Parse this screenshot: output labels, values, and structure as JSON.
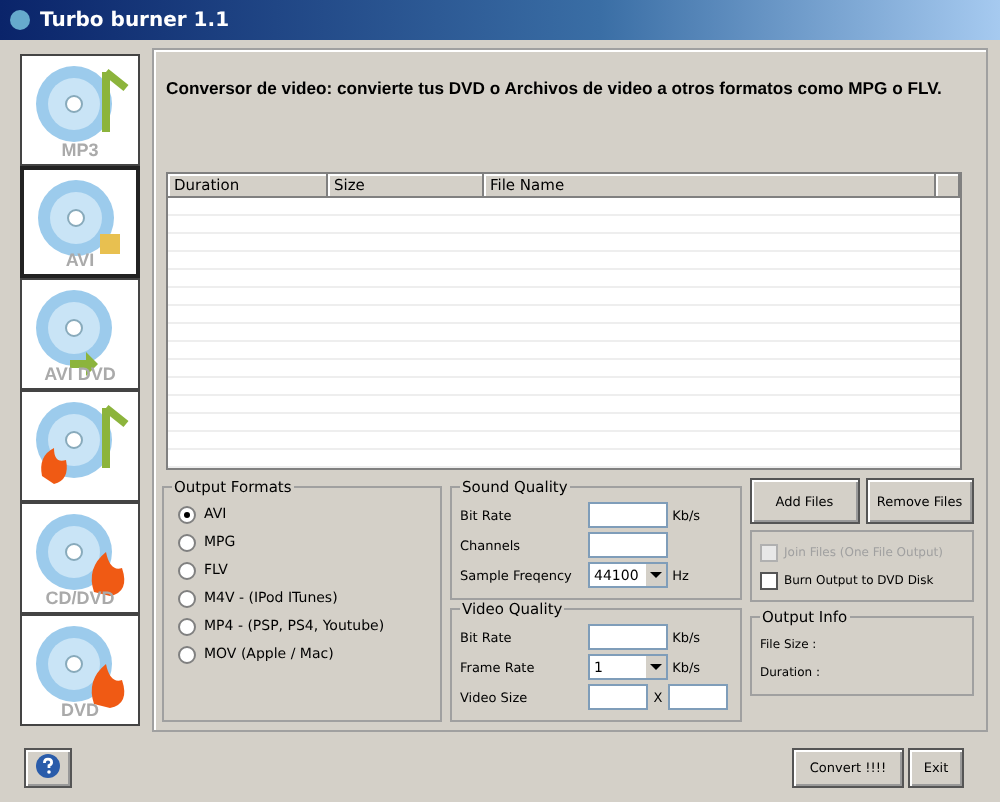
{
  "window": {
    "title": "Turbo burner 1.1"
  },
  "sidebar": {
    "items": [
      {
        "label": "MP3",
        "kind": "music",
        "selected": false
      },
      {
        "label": "AVI",
        "kind": "file",
        "selected": true
      },
      {
        "label": "AVI",
        "label_2": "DVD",
        "kind": "convert",
        "selected": false
      },
      {
        "kind": "burn-music",
        "selected": false
      },
      {
        "label": "CD/DVD",
        "kind": "burn",
        "selected": false
      },
      {
        "label": "DVD",
        "kind": "burn",
        "selected": false
      }
    ]
  },
  "header": "Conversor de video: convierte tus DVD o Archivos de video a otros formatos como MPG o FLV.",
  "table": {
    "columns": [
      "Duration",
      "Size",
      "File Name"
    ]
  },
  "output_formats": {
    "title": "Output Formats",
    "options": [
      {
        "label": "AVI",
        "selected": true
      },
      {
        "label": "MPG",
        "selected": false
      },
      {
        "label": "FLV",
        "selected": false
      },
      {
        "label": "M4V - (IPod ITunes)",
        "selected": false
      },
      {
        "label": "MP4 - (PSP, PS4, Youtube)",
        "selected": false
      },
      {
        "label": "MOV (Apple / Mac)",
        "selected": false
      }
    ]
  },
  "sound_quality": {
    "title": "Sound Quality",
    "bit_rate": {
      "label": "Bit Rate",
      "unit": "Kb/s"
    },
    "channels": {
      "label": "Channels"
    },
    "sample_frequency": {
      "label": "Sample Freqency",
      "value": "44100",
      "unit": "Hz"
    }
  },
  "video_quality": {
    "title": "Video Quality",
    "bit_rate": {
      "label": "Bit Rate",
      "unit": "Kb/s"
    },
    "frame_rate": {
      "label": "Frame Rate",
      "value": "1",
      "unit": "Kb/s"
    },
    "video_size": {
      "label": "Video Size",
      "separator": "X"
    }
  },
  "buttons": {
    "add": "Add Files",
    "remove": "Remove Files",
    "convert": "Convert !!!!",
    "exit": "Exit"
  },
  "options": [
    {
      "label": "Join Files (One File Output)",
      "checked": false,
      "disabled": true
    },
    {
      "label": "Burn Output to DVD Disk",
      "checked": false,
      "disabled": false
    }
  ],
  "output_info": {
    "title": "Output Info",
    "file_size": "File Size :",
    "duration": "Duration :"
  }
}
